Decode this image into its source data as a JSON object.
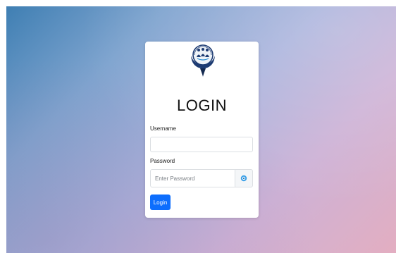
{
  "page": {
    "background_colors": [
      "#3f7fb3",
      "#a9b2dc",
      "#e3aec1"
    ]
  },
  "login_card": {
    "logo_icon": "organization-logo-icon",
    "title": "LOGIN",
    "username": {
      "label": "Username",
      "value": "",
      "placeholder": ""
    },
    "password": {
      "label": "Password",
      "value": "",
      "placeholder": "Enter Password",
      "toggle_icon": "eye-icon"
    },
    "submit_label": "Login",
    "accent_color": "#0d6efd"
  }
}
